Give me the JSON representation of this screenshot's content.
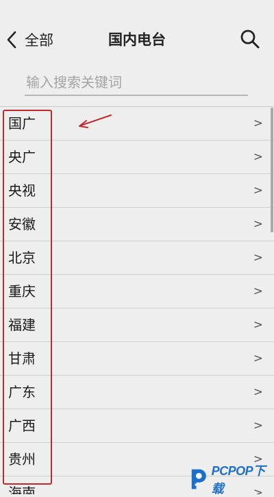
{
  "header": {
    "back_label": "全部",
    "title": "国内电台",
    "back_icon": "chevron-left-icon",
    "search_icon": "search-icon"
  },
  "search": {
    "placeholder": "输入搜索关键词",
    "value": ""
  },
  "list": {
    "items": [
      {
        "label": "国广",
        "chevron": ">"
      },
      {
        "label": "央广",
        "chevron": ">"
      },
      {
        "label": "央视",
        "chevron": ">"
      },
      {
        "label": "安徽",
        "chevron": ">"
      },
      {
        "label": "北京",
        "chevron": ">"
      },
      {
        "label": "重庆",
        "chevron": ">"
      },
      {
        "label": "福建",
        "chevron": ">"
      },
      {
        "label": "甘肃",
        "chevron": ">"
      },
      {
        "label": "广东",
        "chevron": ">"
      },
      {
        "label": "广西",
        "chevron": ">"
      },
      {
        "label": "贵州",
        "chevron": ">"
      },
      {
        "label": "海南",
        "chevron": ">"
      }
    ]
  },
  "annotation": {
    "color": "#c0282d"
  },
  "watermark": {
    "text": "PCPOP下载",
    "color": "#1e6fc8"
  }
}
